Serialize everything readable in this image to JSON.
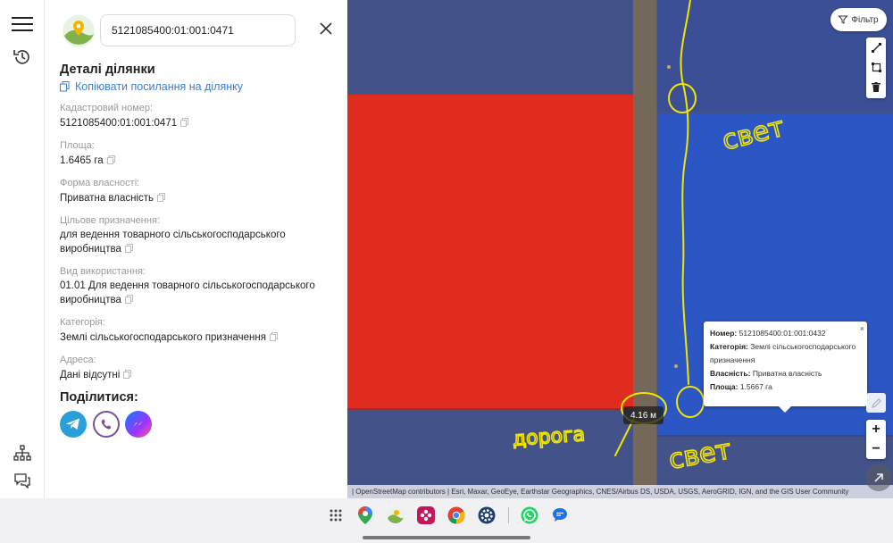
{
  "search": {
    "value": "5121085400:01:001:0471"
  },
  "details": {
    "title": "Деталі ділянки",
    "copy_link_label": "Копіювати посилання на ділянку",
    "fields": [
      {
        "label": "Кадастровий номер:",
        "value": "5121085400:01:001:0471"
      },
      {
        "label": "Площа:",
        "value": "1.6465 га"
      },
      {
        "label": "Форма власності:",
        "value": "Приватна власність"
      },
      {
        "label": "Цільове призначення:",
        "value": "для ведення товарного сільськогосподарського виробництва"
      },
      {
        "label": "Вид використання:",
        "value": "01.01 Для ведення товарного сільськогосподарського виробництва"
      },
      {
        "label": "Категорія:",
        "value": "Землі сільськогосподарського призначення"
      },
      {
        "label": "Адреса:",
        "value": "Дані відсутні"
      }
    ]
  },
  "share": {
    "title": "Поділитися:",
    "buttons": [
      {
        "name": "telegram",
        "color": "#2aa0da"
      },
      {
        "name": "viber",
        "color": "#7b519d"
      },
      {
        "name": "messenger",
        "color": "#0a7cff"
      }
    ]
  },
  "map": {
    "filter_label": "Фільтр",
    "measure_label": "4.16 м",
    "zoom_in": "+",
    "zoom_out": "−",
    "attribution": "| OpenStreetMap contributors | Esri, Maxar, GeoEye, Earthstar Geographics, CNES/Airbus DS, USDA, USGS, AeroGRID, IGN, and the GIS User Community",
    "colors": {
      "red_parcel": "#e02b1f",
      "blue_parcel": "#2b56c4",
      "background": "#44528a",
      "road": "#7a6a55",
      "handwriting": "#f2e600"
    },
    "handwriting": {
      "top": "свет",
      "bottom": "свет",
      "road": "дорога"
    },
    "popup": {
      "number_label": "Номер:",
      "number_value": "5121085400:01:001:0432",
      "category_label": "Категорія:",
      "category_value": "Землі сільськогосподарського призначення",
      "ownership_label": "Власність:",
      "ownership_value": "Приватна власність",
      "area_label": "Площа:",
      "area_value": "1.5667 га",
      "close": "×"
    }
  },
  "taskbar": {
    "apps": [
      "apps-grid-icon",
      "maps-icon",
      "photos-icon",
      "flower-app-icon",
      "chrome-icon",
      "settings-app-icon",
      "whatsapp-icon",
      "messages-icon"
    ]
  }
}
